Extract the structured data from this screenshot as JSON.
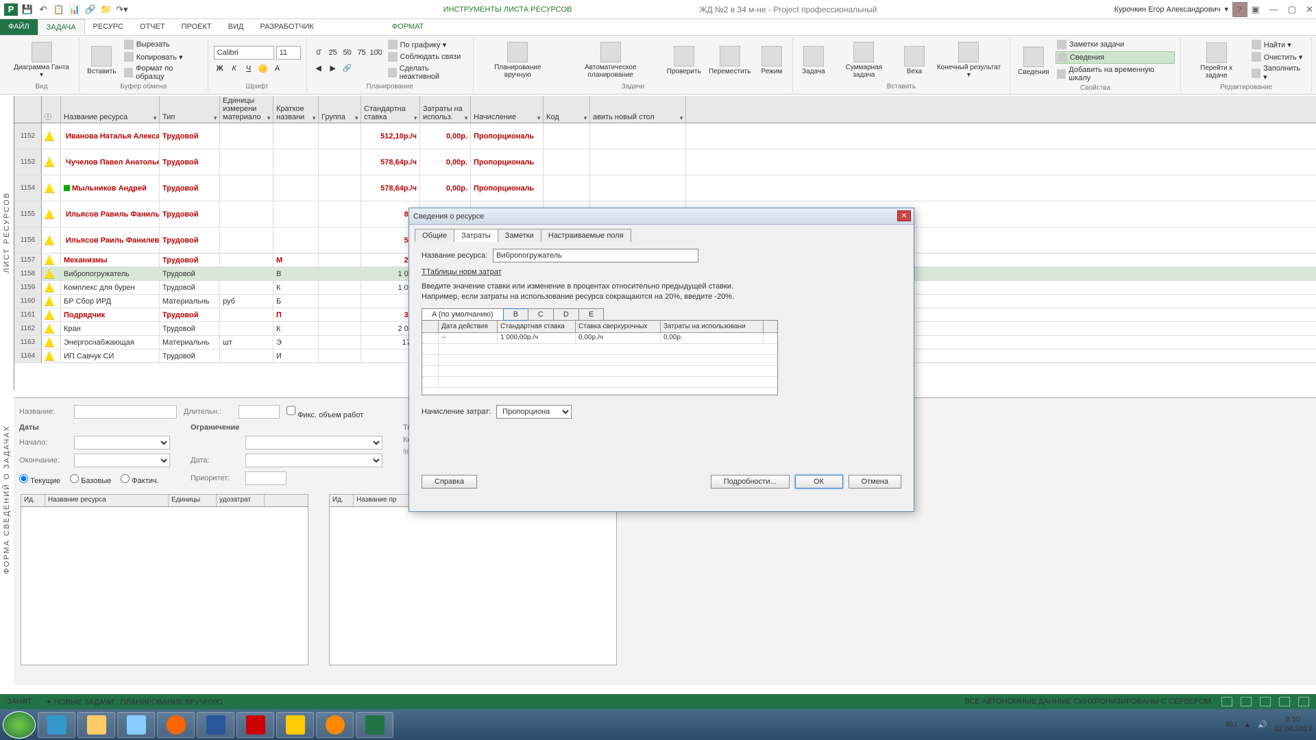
{
  "titlebar": {
    "tool_context": "ИНСТРУМЕНТЫ ЛИСТА РЕСУРСОВ",
    "project_title": "ЖД №2 в 34 м-не - Project профессиональный",
    "user": "Курочкин Егор Александрович"
  },
  "tabs": {
    "file": "ФАЙЛ",
    "task": "ЗАДАЧА",
    "resource": "РЕСУРС",
    "report": "ОТЧЕТ",
    "project": "ПРОЕКТ",
    "view": "ВИД",
    "developer": "РАЗРАБОТЧИК",
    "format": "ФОРМАТ"
  },
  "ribbon": {
    "gantt": "Диаграмма Ганта ▾",
    "view": "Вид",
    "paste": "Вставить",
    "cut": "Вырезать",
    "copy": "Копировать ▾",
    "fmt_painter": "Формат по образцу",
    "clipboard": "Буфер обмена",
    "font_name": "Calibri",
    "font_size": "11",
    "font": "Шрифт",
    "schedule": "Планирование",
    "by_graphic": "По графику ▾",
    "respect_links": "Соблюдать связи",
    "make_inactive": "Сделать неактивной",
    "plan_manual": "Планирование вручную",
    "plan_auto": "Автоматическое планирование",
    "tasks": "Задачи",
    "check": "Проверить",
    "move": "Переместить",
    "mode": "Режим",
    "task_btn": "Задача",
    "summary": "Суммарная задача",
    "milestone": "Веха",
    "deliverable": "Конечный результат ▾",
    "insert": "Вставить",
    "info": "Сведения",
    "task_notes": "Заметки задачи",
    "details": "Сведения",
    "add_timeline": "Добавить на временную шкалу",
    "properties": "Свойства",
    "scroll_task": "Перейти к задаче",
    "find": "Найти ▾",
    "clear": "Очистить ▾",
    "fill": "Заполнить ▾",
    "editing": "Редактирование"
  },
  "side": {
    "resources": "ЛИСТ РЕСУРСОВ",
    "form": "ФОРМА СВЕДЕНИЙ О ЗАДАЧАХ"
  },
  "grid": {
    "headers": {
      "indicator": "",
      "name": "Название ресурса",
      "type": "Тип",
      "material": "Единицы измерени материало",
      "short": "Краткое названи",
      "group": "Группа",
      "std_rate": "Стандартна ставка",
      "cost_use": "Затраты на использ.",
      "accrue": "Начисление",
      "code": "Код",
      "add_col": "авить новый стол"
    },
    "rows": [
      {
        "num": "1152",
        "name": "Иванова Наталья Александровна",
        "type": "Трудовой",
        "rate": "512,10р./ч",
        "cost": "0,00р.",
        "accr": "Пропорциональ",
        "red": true,
        "sq": "red",
        "dbl": true
      },
      {
        "num": "1153",
        "name": "Чучелов Павел Анатольевич",
        "type": "Трудовой",
        "rate": "578,64р./ч",
        "cost": "0,00р.",
        "accr": "Пропорциональ",
        "red": true,
        "sq": "red",
        "dbl": true
      },
      {
        "num": "1154",
        "name": "Мыльников Андрей",
        "type": "Трудовой",
        "rate": "578,64р./ч",
        "cost": "0,00р.",
        "accr": "Пропорциональ",
        "red": true,
        "sq": "green",
        "dbl": true
      },
      {
        "num": "1155",
        "name": "Ильясов Равиль Фанильевич",
        "type": "Трудовой",
        "rate": "850",
        "cost": "",
        "accr": "",
        "red": true,
        "sq": "green",
        "dbl": true
      },
      {
        "num": "1156",
        "name": "Ильясов Раиль Фанилевич",
        "type": "Трудовой",
        "rate": "512",
        "cost": "",
        "accr": "",
        "red": true,
        "sq": "green",
        "dbl": true
      },
      {
        "num": "1157",
        "name": "Механизмы",
        "type": "Трудовой",
        "short": "М",
        "rate": "271",
        "cost": "",
        "accr": "",
        "red": true
      },
      {
        "num": "1158",
        "name": "Вибропогружатель",
        "type": "Трудовой",
        "short": "В",
        "rate": "1 000",
        "cost": "",
        "accr": "",
        "sel": true
      },
      {
        "num": "1159",
        "name": "Комплекс для бурен",
        "type": "Трудовой",
        "short": "К",
        "rate": "1 000",
        "cost": "",
        "accr": ""
      },
      {
        "num": "1160",
        "name": "БР Сбор ИРД",
        "type": "Материальнь",
        "mat": "руб",
        "short": "Б",
        "rate": "",
        "cost": "",
        "accr": ""
      },
      {
        "num": "1161",
        "name": "Подрядчик",
        "type": "Трудовой",
        "short": "П",
        "rate": "300",
        "cost": "",
        "accr": "",
        "red": true
      },
      {
        "num": "1162",
        "name": "Кран",
        "type": "Трудовой",
        "short": "К",
        "rate": "2 000",
        "cost": "",
        "accr": ""
      },
      {
        "num": "1163",
        "name": "Энергоснабжающая",
        "type": "Материальнь",
        "mat": "шт",
        "short": "Э",
        "rate": "17 7",
        "cost": "",
        "accr": ""
      },
      {
        "num": "1164",
        "name": "ИП Савчук СИ",
        "type": "Трудовой",
        "short": "И",
        "rate": "",
        "cost": "",
        "accr": ""
      }
    ]
  },
  "form": {
    "name": "Название:",
    "duration": "Длительн.:",
    "fixed": "Фикс. объем работ",
    "dates": "Даты",
    "start": "Начало:",
    "end": "Окончание:",
    "constraint": "Ограничение",
    "date": "Дата:",
    "priority": "Приоритет:",
    "task_type": "Тип задачи",
    "wbs": "Код СДР:",
    "pct": "% заверше",
    "current": "Текущие",
    "baseline": "Базовые",
    "actual": "Фактич.",
    "mini_headers": {
      "id": "Ид.",
      "name": "Название ресурса",
      "units": "Единицы",
      "cost": "удозатрат",
      "pred": "Название пр"
    }
  },
  "dialog": {
    "title": "Сведения о ресурсе",
    "tabs": {
      "general": "Общие",
      "costs": "Затраты",
      "notes": "Заметки",
      "custom": "Настраиваемые поля"
    },
    "name_label": "Название ресурса:",
    "name_value": "Вибропогружатель",
    "tables_label": "Таблицы норм затрат",
    "hint1": "Введите значение ставки или изменение в процентах относительно предыдущей ставки.",
    "hint2": "Например, если затраты на использование ресурса сокращаются на 20%, введите -20%.",
    "rate_tabs": {
      "a": "A (по умолчанию)",
      "b": "B",
      "c": "C",
      "d": "D",
      "e": "E"
    },
    "rate_headers": {
      "date": "Дата действия",
      "std": "Стандартная ставка",
      "ovt": "Ставка сверхурочных",
      "peruse": "Затраты на использовани"
    },
    "rate_row": {
      "date": "--",
      "std": "1 000,00р./ч",
      "ovt": "0,00р./ч",
      "peruse": "0,00р."
    },
    "accrue_label": "Начисление затрат:",
    "accrue_value": "Пропорциона",
    "help": "Справка",
    "details": "Подробности...",
    "ok": "ОК",
    "cancel": "Отмена"
  },
  "status": {
    "busy": "ЗАНЯТ",
    "new_tasks": "✦ НОВЫЕ ЗАДАЧИ : ПЛАНИРОВАНИЕ ВРУЧНУЮ",
    "sync": "ВСЕ АВТОНОМНЫЕ ДАННЫЕ СИНХРОНИЗИРОВАНЫ С СЕРВЕРОМ."
  },
  "tray": {
    "lang": "RU",
    "time": "8:50",
    "date": "02.04.2013"
  }
}
